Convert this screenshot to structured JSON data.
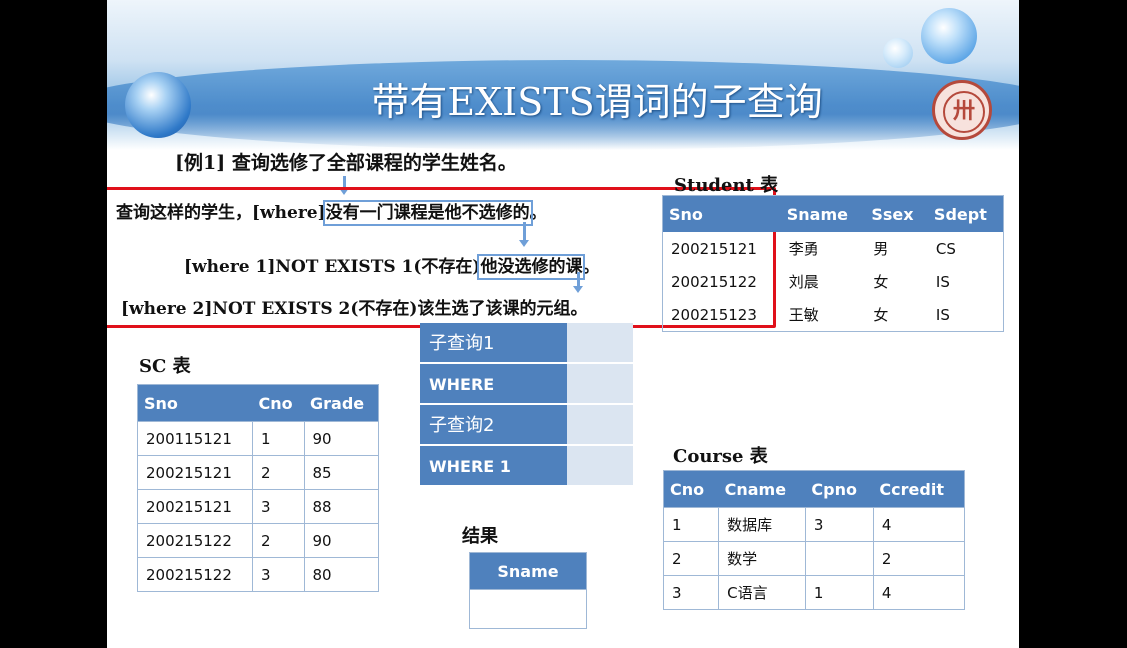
{
  "slide": {
    "title": "带有EXISTS谓词的子查询",
    "logo_glyph": "卅",
    "example": "[例1] 查询选修了全部课程的学生姓名。",
    "line1_a": "查询这样的学生，[where]",
    "line1_b": "没有一门课程是他不选修的",
    "line1_c": "。",
    "line2_a": "[where 1]NOT EXISTS 1(不存在)",
    "line2_b": "他没选修的课",
    "line2_c": "。",
    "line3": "[where 2]NOT EXISTS 2(不存在)该生选了该课的元组。"
  },
  "student_table": {
    "caption": "Student 表",
    "headers": [
      "Sno",
      "Sname",
      "Ssex",
      "Sdept"
    ],
    "rows": [
      [
        "200215121",
        "李勇",
        "男",
        "CS"
      ],
      [
        "200215122",
        "刘晨",
        "女",
        "IS"
      ],
      [
        "200215123",
        "王敏",
        "女",
        "IS"
      ]
    ]
  },
  "sc_table": {
    "caption": "SC 表",
    "headers": [
      "Sno",
      "Cno",
      "Grade"
    ],
    "rows": [
      [
        "200115121",
        "1",
        "90"
      ],
      [
        "200215121",
        "2",
        "85"
      ],
      [
        "200215121",
        "3",
        "88"
      ],
      [
        "200215122",
        "2",
        "90"
      ],
      [
        "200215122",
        "3",
        "80"
      ]
    ]
  },
  "subquery_panel": {
    "rows": [
      "子查询1",
      "WHERE",
      "子查询2",
      "WHERE 1"
    ]
  },
  "course_table": {
    "caption": "Course 表",
    "headers": [
      "Cno",
      "Cname",
      "Cpno",
      "Ccredit"
    ],
    "rows": [
      [
        "1",
        "数据库",
        "3",
        "4"
      ],
      [
        "2",
        "数学",
        "",
        "2"
      ],
      [
        "3",
        "C语言",
        "1",
        "4"
      ]
    ]
  },
  "result_table": {
    "caption": "结果",
    "headers": [
      "Sname"
    ]
  }
}
